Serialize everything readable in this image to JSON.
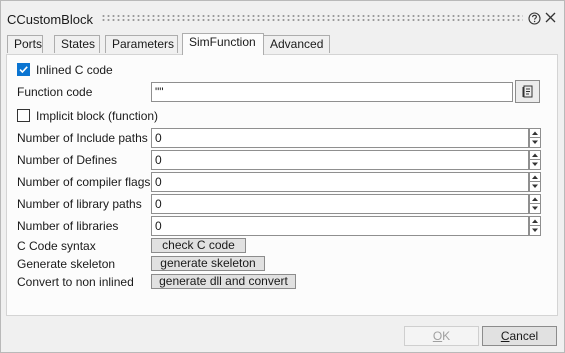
{
  "window": {
    "title": "CCustomBlock",
    "help_icon": "question-circle-icon",
    "close_icon": "close-icon"
  },
  "tabs": [
    {
      "label": "Ports",
      "active": false
    },
    {
      "label": "States",
      "active": false
    },
    {
      "label": "Parameters",
      "active": false
    },
    {
      "label": "SimFunction",
      "active": true
    },
    {
      "label": "Advanced",
      "active": false
    }
  ],
  "simfunction": {
    "inlined": {
      "label": "Inlined C code",
      "checked": true
    },
    "function_code": {
      "label": "Function code",
      "value": "\"\"",
      "browse_icon": "document-edit-icon"
    },
    "implicit": {
      "label": "Implicit block (function)",
      "checked": false
    },
    "counts": [
      {
        "label": "Number of Include paths",
        "value": "0"
      },
      {
        "label": "Number of Defines",
        "value": "0"
      },
      {
        "label": "Number of compiler flags",
        "value": "0"
      },
      {
        "label": "Number of library paths",
        "value": "0"
      },
      {
        "label": "Number of libraries",
        "value": "0"
      }
    ],
    "actions": [
      {
        "label": "C Code syntax",
        "button": "check C code"
      },
      {
        "label": "Generate skeleton",
        "button": "generate skeleton"
      },
      {
        "label": "Convert to non inlined",
        "button": "generate dll and convert"
      }
    ]
  },
  "footer": {
    "ok_prefix": "O",
    "ok_rest": "K",
    "ok_enabled": false,
    "cancel_prefix": "C",
    "cancel_rest": "ancel"
  },
  "colors": {
    "accent": "#0a74d1",
    "disabled_text": "#a0a0a0"
  }
}
